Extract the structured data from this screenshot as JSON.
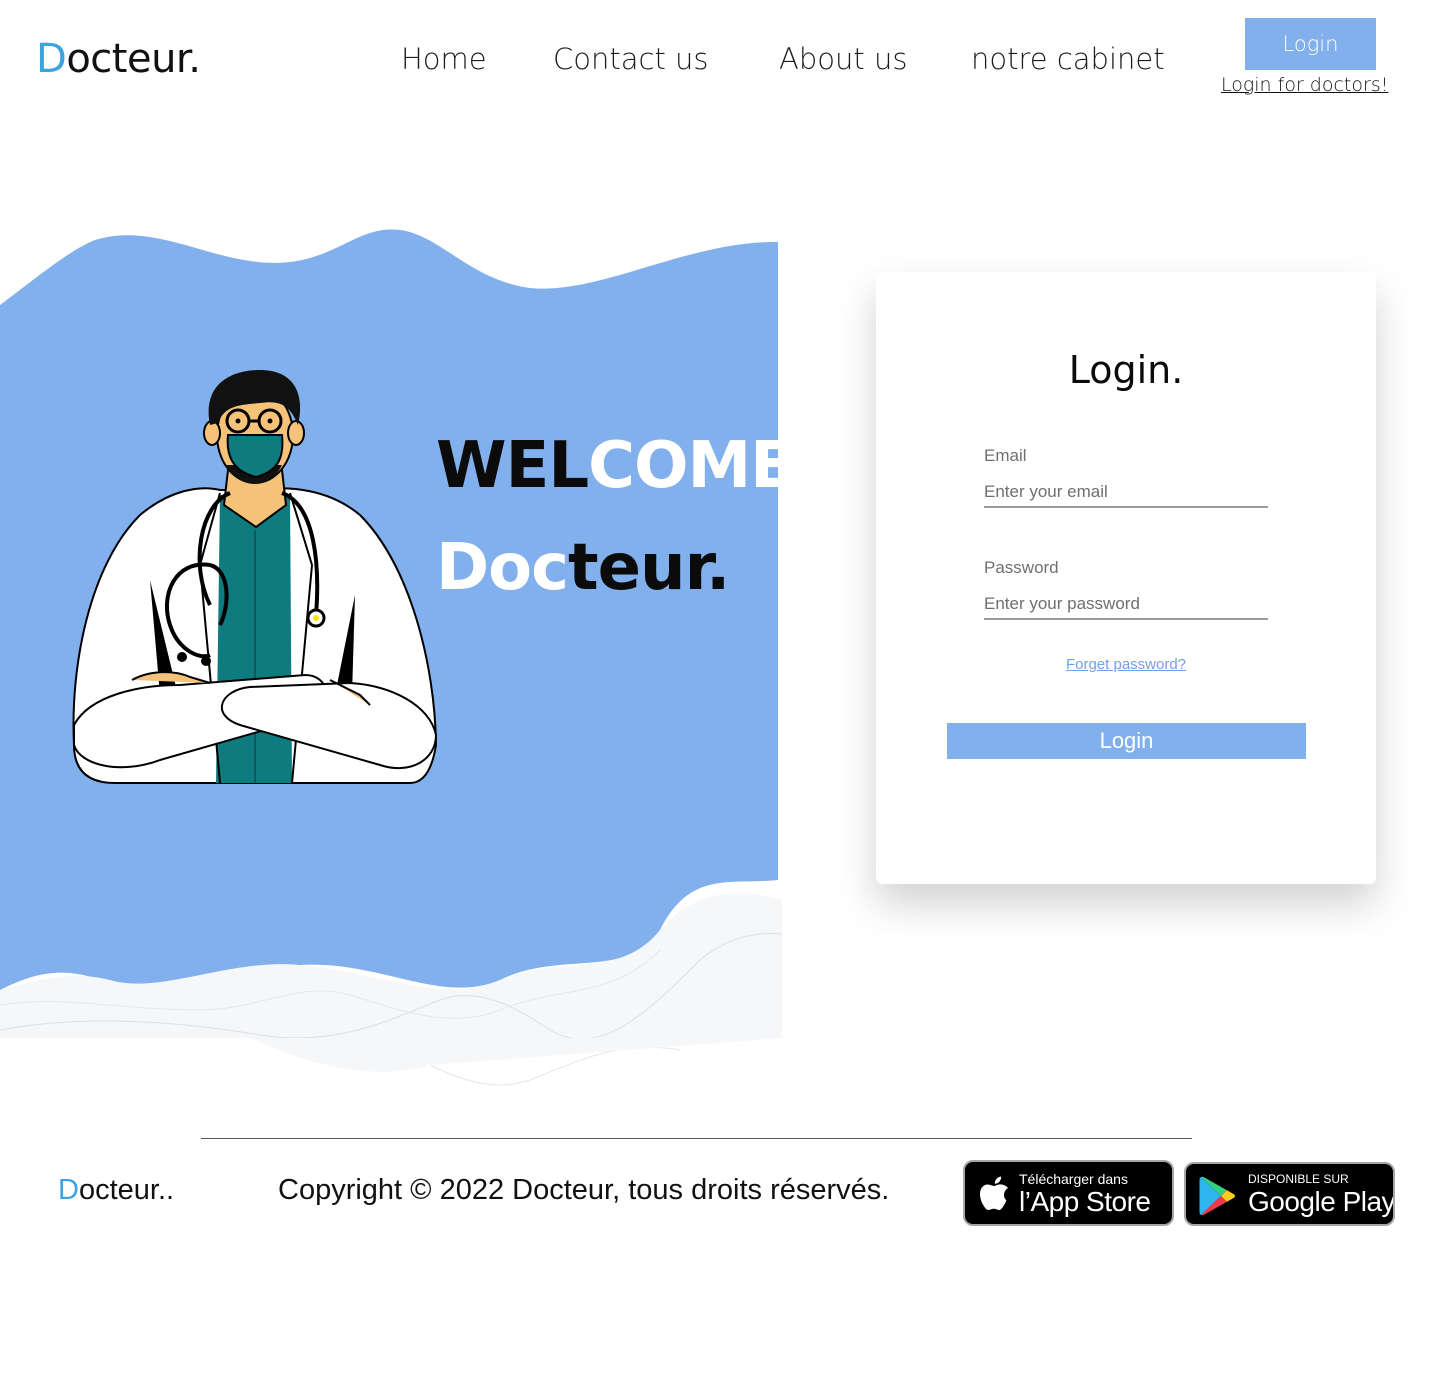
{
  "brand": {
    "first_letter": "D",
    "rest": "octeur."
  },
  "nav": {
    "home": "Home",
    "contact": "Contact us",
    "about": "About us",
    "cabinet": "notre cabinet"
  },
  "header_login": {
    "button_label": "Login",
    "doctors_link": "Login for doctors!"
  },
  "hero": {
    "welcome_dark": "WEL",
    "welcome_light": "COME",
    "brand_light": "Doc",
    "brand_dark": "teur."
  },
  "login_card": {
    "title": "Login.",
    "email_label": "Email",
    "email_placeholder": "Enter your email",
    "password_label": "Password",
    "password_placeholder": "Enter your password",
    "forgot_link": "Forget password?",
    "submit_label": "Login"
  },
  "footer": {
    "logo_first_letter": "D",
    "logo_rest": "octeur..",
    "copyright": "Copyright © 2022 Docteur, tous droits réservés.",
    "app_store": {
      "small": "Télécharger dans",
      "big": "l’App Store"
    },
    "google_play": {
      "small": "DISPONIBLE SUR",
      "big": "Google Play"
    }
  },
  "colors": {
    "accent": "#82b0ec",
    "brand_blue": "#3ea2e0",
    "link": "#6fa2e6"
  },
  "icons": [
    "doctor-illustration",
    "apple-icon",
    "google-play-icon"
  ]
}
